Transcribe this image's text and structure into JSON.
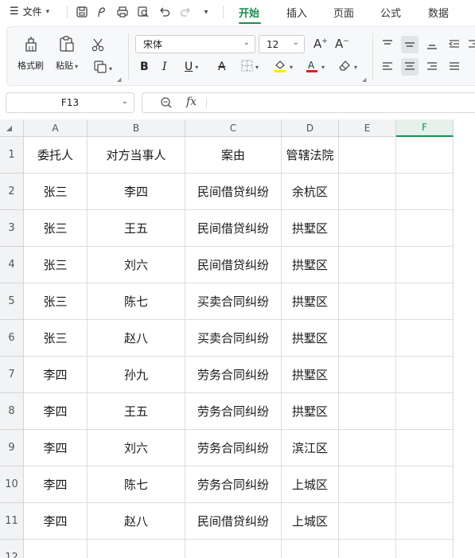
{
  "menu": {
    "file_label": "文件"
  },
  "tabs": [
    {
      "label": "开始",
      "active": true
    },
    {
      "label": "插入",
      "active": false
    },
    {
      "label": "页面",
      "active": false
    },
    {
      "label": "公式",
      "active": false
    },
    {
      "label": "数据",
      "active": false
    }
  ],
  "ribbon": {
    "format_painter_label": "格式刷",
    "paste_label": "粘贴",
    "font_name": "宋体",
    "font_size": "12"
  },
  "formula_bar": {
    "cell_ref": "F13",
    "fx_label": "fx",
    "content": ""
  },
  "colors": {
    "accent": "#1a8f4e",
    "highlight": "#ffe600",
    "font_color": "#e02020"
  },
  "sheet": {
    "columns": [
      "A",
      "B",
      "C",
      "D",
      "E",
      "F"
    ],
    "selected_column": "F",
    "rows": [
      {
        "num": "1",
        "cells": [
          "委托人",
          "对方当事人",
          "案由",
          "管辖法院",
          "",
          ""
        ]
      },
      {
        "num": "2",
        "cells": [
          "张三",
          "李四",
          "民间借贷纠纷",
          "余杭区",
          "",
          ""
        ]
      },
      {
        "num": "3",
        "cells": [
          "张三",
          "王五",
          "民间借贷纠纷",
          "拱墅区",
          "",
          ""
        ]
      },
      {
        "num": "4",
        "cells": [
          "张三",
          "刘六",
          "民间借贷纠纷",
          "拱墅区",
          "",
          ""
        ]
      },
      {
        "num": "5",
        "cells": [
          "张三",
          "陈七",
          "买卖合同纠纷",
          "拱墅区",
          "",
          ""
        ]
      },
      {
        "num": "6",
        "cells": [
          "张三",
          "赵八",
          "买卖合同纠纷",
          "拱墅区",
          "",
          ""
        ]
      },
      {
        "num": "7",
        "cells": [
          "李四",
          "孙九",
          "劳务合同纠纷",
          "拱墅区",
          "",
          ""
        ]
      },
      {
        "num": "8",
        "cells": [
          "李四",
          "王五",
          "劳务合同纠纷",
          "拱墅区",
          "",
          ""
        ]
      },
      {
        "num": "9",
        "cells": [
          "李四",
          "刘六",
          "劳务合同纠纷",
          "滨江区",
          "",
          ""
        ]
      },
      {
        "num": "10",
        "cells": [
          "李四",
          "陈七",
          "劳务合同纠纷",
          "上城区",
          "",
          ""
        ]
      },
      {
        "num": "11",
        "cells": [
          "李四",
          "赵八",
          "民间借贷纠纷",
          "上城区",
          "",
          ""
        ]
      },
      {
        "num": "12",
        "cells": [
          "",
          "",
          "",
          "",
          "",
          ""
        ]
      }
    ]
  }
}
